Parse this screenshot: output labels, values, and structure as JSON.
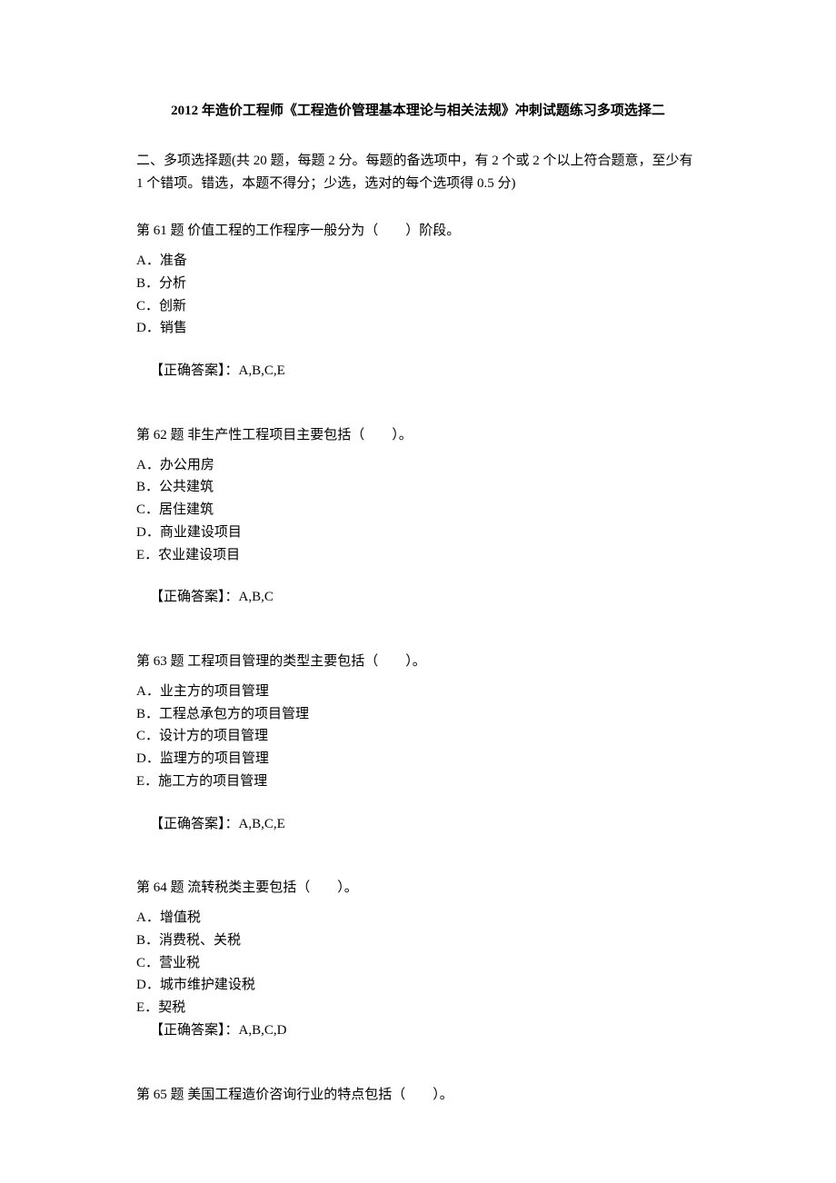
{
  "title": "2012 年造价工程师《工程造价管理基本理论与相关法规》冲刺试题练习多项选择二",
  "intro": "二、多项选择题(共 20 题，每题 2 分。每题的备选项中，有 2 个或 2 个以上符合题意，至少有 1 个错项。错选，本题不得分；少选，选对的每个选项得 0.5 分)",
  "answer_label": "【正确答案】：",
  "questions": [
    {
      "stem": "第 61 题  价值工程的工作程序一般分为（　　）阶段。",
      "options": [
        "A．准备",
        "B．分析",
        "C．创新",
        "D．销售"
      ],
      "answer": "A,B,C,E",
      "tight": false
    },
    {
      "stem": "第 62 题  非生产性工程项目主要包括（　　）。",
      "options": [
        "A．办公用房",
        "B．公共建筑",
        "C．居住建筑",
        "D．商业建设项目",
        "E．农业建设项目"
      ],
      "answer": "A,B,C",
      "tight": false
    },
    {
      "stem": "第 63 题  工程项目管理的类型主要包括（　　）。",
      "options": [
        "A．业主方的项目管理",
        "B．工程总承包方的项目管理",
        "C．设计方的项目管理",
        "D．监理方的项目管理",
        "E．施工方的项目管理"
      ],
      "answer": "A,B,C,E",
      "tight": false
    },
    {
      "stem": "第 64 题  流转税类主要包括（　　）。",
      "options": [
        "A．增值税",
        "B．消费税、关税",
        "C．营业税",
        "D．城市维护建设税",
        "E．契税"
      ],
      "answer": "A,B,C,D",
      "tight": true
    },
    {
      "stem": "第 65 题  美国工程造价咨询行业的特点包括（　　）。",
      "options": [],
      "answer": "",
      "tight": false
    }
  ]
}
